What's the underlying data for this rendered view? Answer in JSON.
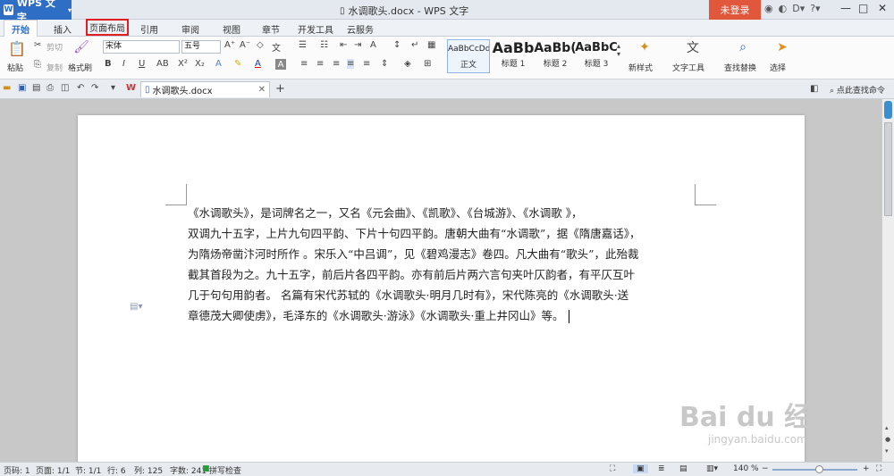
{
  "titlebar": {
    "app_name": "WPS 文字",
    "window_title": "水调歌头.docx - WPS 文字",
    "login_label": "未登录"
  },
  "tabs": [
    "开始",
    "插入",
    "页面布局",
    "引用",
    "审阅",
    "视图",
    "章节",
    "开发工具",
    "云服务"
  ],
  "toolbar": {
    "paste": "粘贴",
    "cut": "剪切",
    "copy": "复制",
    "format_painter": "格式刷",
    "font_name": "宋体",
    "font_size": "五号",
    "styles": [
      {
        "preview": "AaBbCcDd",
        "label": "正文"
      },
      {
        "preview": "AaBb",
        "label": "标题 1"
      },
      {
        "preview": "AaBb(",
        "label": "标题 2"
      },
      {
        "preview": "AaBbC",
        "label": "标题 3"
      }
    ],
    "new_style": "新样式",
    "text_tools": "文字工具",
    "find_replace": "查找替换",
    "select": "选择"
  },
  "quickbar": {
    "doc_tab": "水调歌头.docx",
    "search_command": "点此查找命令"
  },
  "document": {
    "lines": [
      "《水调歌头》，是词牌名之一，又名《元会曲》、《凯歌》、《台城游》、《水调歌 》，",
      "双调九十五字，上片九句四平韵、下片十句四平韵。唐朝大曲有“水调歌”，据《隋唐嘉话》，",
      "为隋炀帝凿汴河时所作 。宋乐入“中吕调”，见《碧鸡漫志》卷四。凡大曲有“歌头”，此殆裁",
      "截其首段为之。九十五字，前后片各四平韵。亦有前后片两六言句夹叶仄韵者，有平仄互叶",
      "几于句句用韵者。 名篇有宋代苏轼的《水调歌头·明月几时有》，宋代陈亮的《水调歌头·送",
      "章德茂大卿使虏》，毛泽东的《水调歌头·游泳》《水调歌头·重上井冈山》等。"
    ]
  },
  "statusbar": {
    "page_num": "页码: 1",
    "pages": "页面: 1/1",
    "section": "节: 1/1",
    "row": "行: 6",
    "col": "列: 125",
    "words": "字数: 241",
    "spell": "拼写检查",
    "zoom": "140 %"
  },
  "watermark": {
    "main": "Bai du 经验",
    "sub": "jingyan.baidu.com"
  },
  "colors": {
    "accent": "#2e6fc5",
    "login": "#e0573b",
    "highlight": "#e02020"
  }
}
